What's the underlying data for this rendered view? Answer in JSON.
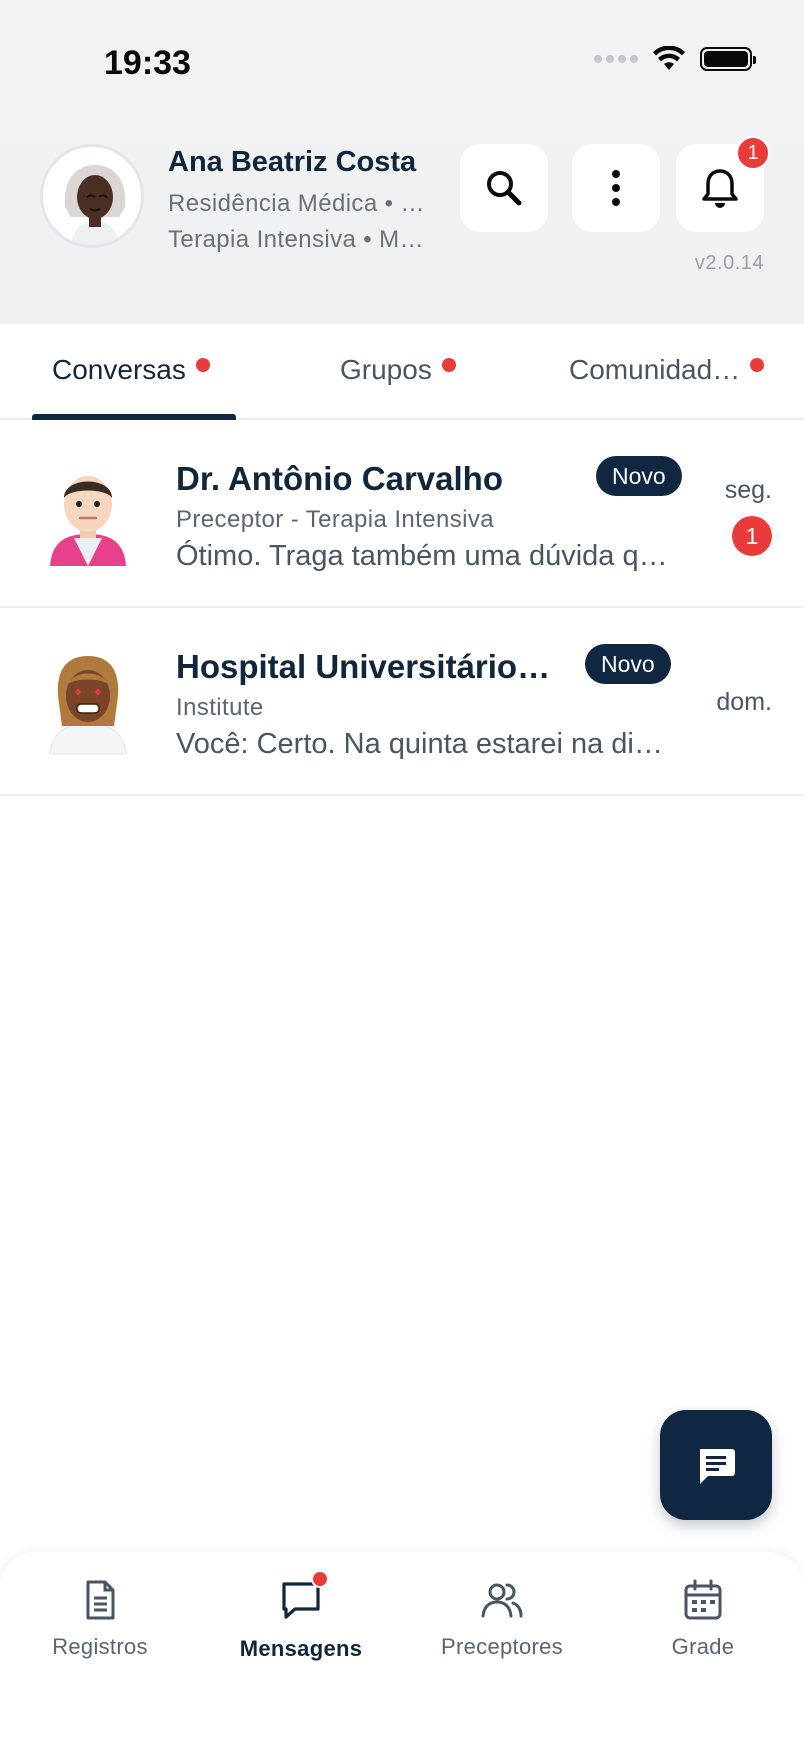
{
  "status_bar": {
    "time": "19:33"
  },
  "profile": {
    "name": "Ana Beatriz Costa",
    "line1": "Residência Médica • …",
    "line2": "Terapia Intensiva • M…",
    "version": "v2.0.14"
  },
  "header": {
    "notification_count": "1"
  },
  "tabs": [
    {
      "label": "Conversas",
      "has_dot": true,
      "active": true
    },
    {
      "label": "Grupos",
      "has_dot": true,
      "active": false
    },
    {
      "label": "Comunidad…",
      "has_dot": true,
      "active": false
    }
  ],
  "chats": [
    {
      "name": "Dr. Antônio Carvalho",
      "subtitle": "Preceptor - Terapia Intensiva",
      "preview": "Ótimo. Traga também uma dúvida q…",
      "badge": "Novo",
      "time": "seg.",
      "unread": "1"
    },
    {
      "name": "Hospital Universitário S…",
      "subtitle": "Institute",
      "preview": "Você: Certo. Na quinta estarei na di…",
      "badge": "Novo",
      "time": "dom.",
      "unread": ""
    }
  ],
  "bottom_nav": [
    {
      "label": "Registros",
      "icon": "document-icon",
      "active": false
    },
    {
      "label": "Mensagens",
      "icon": "chat-icon",
      "active": true
    },
    {
      "label": "Preceptores",
      "icon": "people-icon",
      "active": false
    },
    {
      "label": "Grade",
      "icon": "calendar-icon",
      "active": false
    }
  ],
  "colors": {
    "accent": "#0f2740",
    "alert": "#ea3b3b",
    "text": "#12263a"
  }
}
